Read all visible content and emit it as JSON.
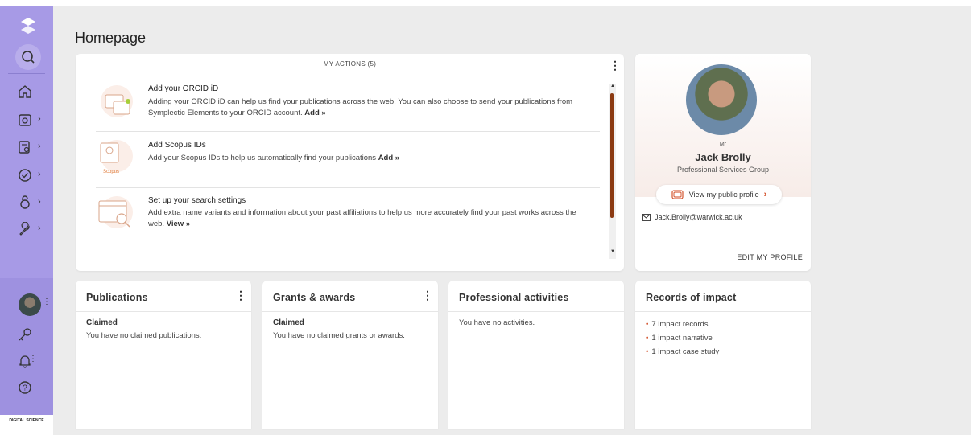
{
  "page": {
    "title": "Homepage"
  },
  "sidebar": {
    "items": [
      {
        "icon": "home-icon",
        "has_submenu": false
      },
      {
        "icon": "publication-search-icon",
        "has_submenu": true
      },
      {
        "icon": "document-search-icon",
        "has_submenu": true
      },
      {
        "icon": "check-circle-icon",
        "has_submenu": true
      },
      {
        "icon": "open-access-icon",
        "has_submenu": true
      },
      {
        "icon": "wrench-icon",
        "has_submenu": true
      }
    ],
    "footer_logo": "DIGITAL SCIENCE"
  },
  "actions": {
    "heading": "MY ACTIONS (5)",
    "items": [
      {
        "title": "Add your ORCID iD",
        "description": "Adding your ORCID iD can help us find your publications across the web. You can also choose to send your publications from Symplectic Elements to your ORCID account.",
        "link": "Add »"
      },
      {
        "title": "Add Scopus IDs",
        "description": "Add your Scopus IDs to help us automatically find your publications",
        "link": "Add »",
        "icon_label": "Scopus"
      },
      {
        "title": "Set up your search settings",
        "description": "Add extra name variants and information about your past affiliations to help us more accurately find your past works across the web.",
        "link": "View »"
      }
    ]
  },
  "profile": {
    "honorific": "Mr",
    "name": "Jack Brolly",
    "group": "Professional Services Group",
    "public_profile_label": "View my public profile",
    "email": "Jack.Brolly@warwick.ac.uk",
    "edit_label": "EDIT MY PROFILE"
  },
  "cards": {
    "publications": {
      "title": "Publications",
      "subtitle": "Claimed",
      "text": "You have no claimed publications."
    },
    "grants": {
      "title": "Grants & awards",
      "subtitle": "Claimed",
      "text": "You have no claimed grants or awards."
    },
    "activities": {
      "title": "Professional activities",
      "text": "You have no activities."
    },
    "impact": {
      "title": "Records of impact",
      "items": [
        "7 impact records",
        "1 impact narrative",
        "1 impact case study"
      ]
    }
  },
  "colors": {
    "sidebar": "#a79ae6",
    "accent": "#d0461d",
    "scroll_thumb": "#8b3a12"
  }
}
